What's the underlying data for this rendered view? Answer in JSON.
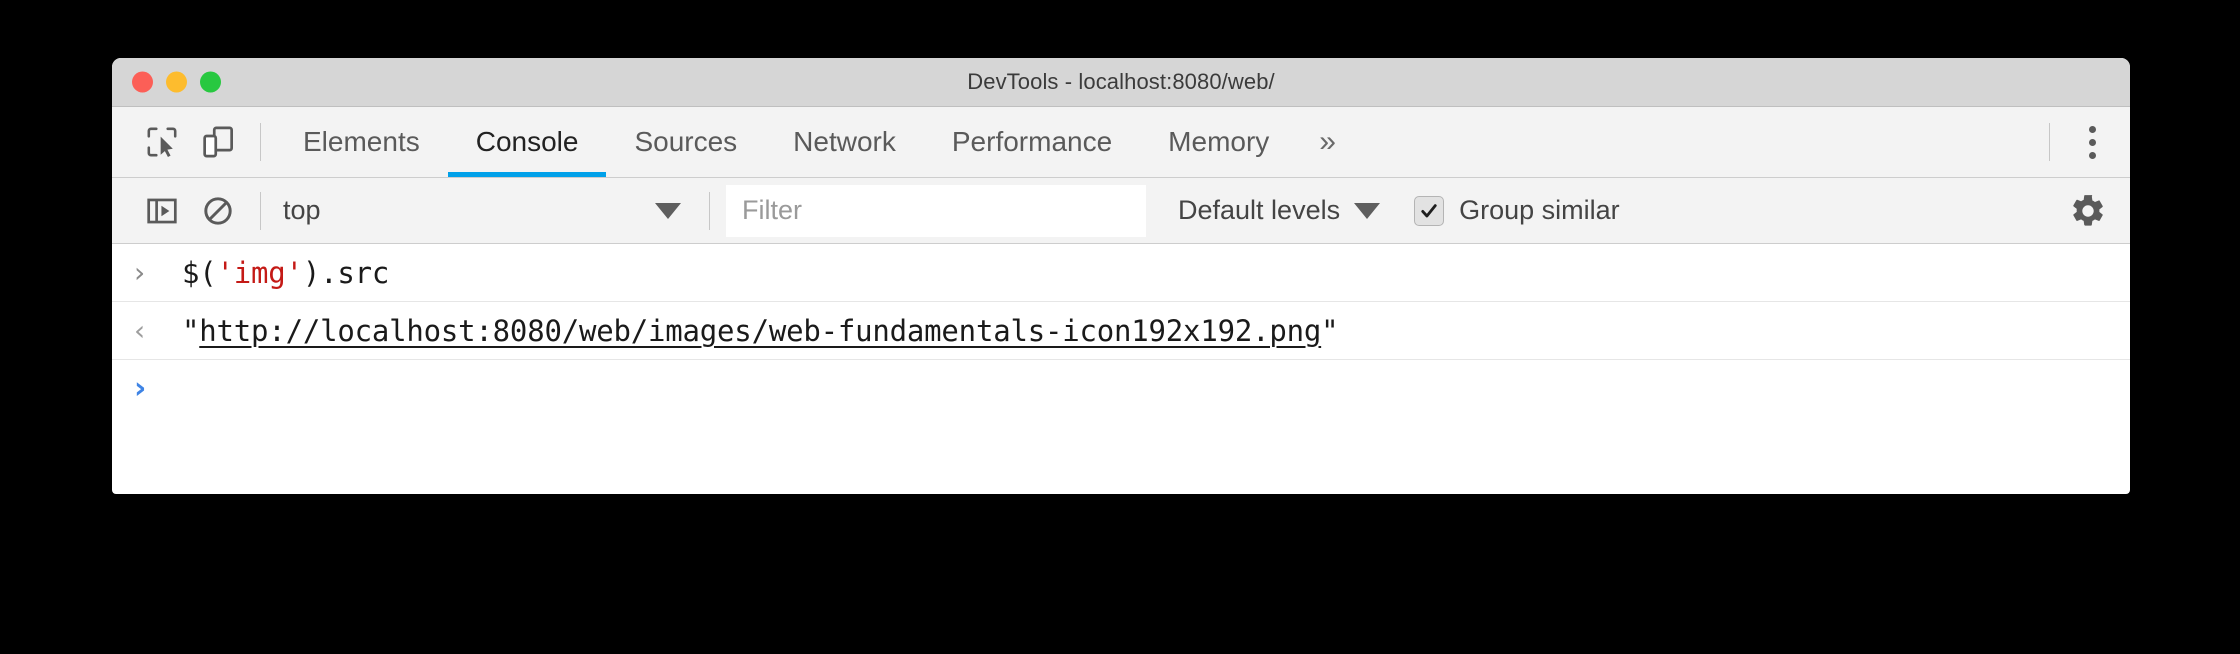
{
  "window": {
    "title": "DevTools - localhost:8080/web/",
    "traffic_lights": [
      {
        "name": "close",
        "color": "#fc5f57"
      },
      {
        "name": "minimize",
        "color": "#fdbc2e"
      },
      {
        "name": "maximize",
        "color": "#28c840"
      }
    ]
  },
  "tab_bar": {
    "inspect_icon": "inspect-element-icon",
    "device_icon": "device-toolbar-icon",
    "tabs": [
      {
        "label": "Elements",
        "active": false
      },
      {
        "label": "Console",
        "active": true
      },
      {
        "label": "Sources",
        "active": false
      },
      {
        "label": "Network",
        "active": false
      },
      {
        "label": "Performance",
        "active": false
      },
      {
        "label": "Memory",
        "active": false
      }
    ],
    "more_tabs_label": "»",
    "kebab_label": "More options",
    "active_tab_color": "#00a0e9"
  },
  "console_toolbar": {
    "sidebar_toggle_icon": "console-sidebar-icon",
    "clear_console_icon": "clear-console-icon",
    "context": {
      "value": "top",
      "caret": "▼"
    },
    "filter": {
      "value": "",
      "placeholder": "Filter"
    },
    "levels": {
      "label": "Default levels",
      "caret": "▼"
    },
    "group_similar": {
      "label": "Group similar",
      "checked": true,
      "check_glyph": "✔"
    },
    "settings_icon": "gear-icon"
  },
  "console": {
    "rows": [
      {
        "type": "input",
        "gutter": "›",
        "segments": [
          {
            "text": "$(",
            "kind": "plain"
          },
          {
            "text": "'img'",
            "kind": "string"
          },
          {
            "text": ").src",
            "kind": "plain"
          }
        ]
      },
      {
        "type": "result",
        "gutter": "‹",
        "quote_open": "\"",
        "url": "http://localhost:8080/web/images/web-fundamentals-icon192x192.png",
        "quote_close": "\""
      },
      {
        "type": "prompt",
        "gutter": "›",
        "value": ""
      }
    ]
  }
}
